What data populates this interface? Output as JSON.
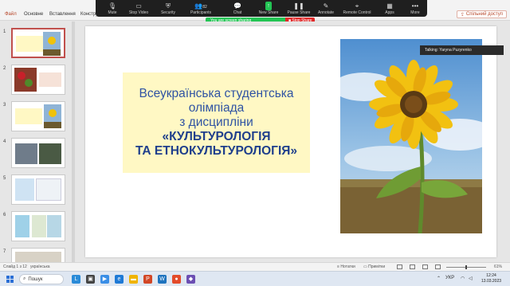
{
  "menu": {
    "file": "Файл",
    "home": "Основне",
    "insert": "Вставлення",
    "design": "Конструктор",
    "share": "Спільний доступ"
  },
  "zoom_toolbar": {
    "items": [
      {
        "label": "Mute",
        "icon": "mic-icon"
      },
      {
        "label": "Stop Video",
        "icon": "video-icon"
      },
      {
        "label": "Security",
        "icon": "shield-icon"
      },
      {
        "label": "Participants",
        "icon": "participants-icon",
        "count": "82"
      },
      {
        "label": "Chat",
        "icon": "chat-icon"
      },
      {
        "label": "New Share",
        "icon": "share-up-icon"
      },
      {
        "label": "Pause Share",
        "icon": "pause-icon"
      },
      {
        "label": "Annotate",
        "icon": "pen-icon"
      },
      {
        "label": "Remote Control",
        "icon": "remote-control-icon"
      },
      {
        "label": "Apps",
        "icon": "apps-icon"
      },
      {
        "label": "More",
        "icon": "more-icon"
      }
    ],
    "sharing_text": "You are screen sharing",
    "stop_share": "Stop Share",
    "accent": "#23c454",
    "stop_color": "#e02828"
  },
  "talking": "Talking: Yaryna Puzyrenko",
  "thumbnails": {
    "numbers": [
      "1",
      "2",
      "3",
      "4",
      "5",
      "6",
      "7"
    ]
  },
  "slide": {
    "title_lines": [
      "Всеукраїнська студентська",
      "олімпіада",
      "з дисципліни"
    ],
    "subject_lines": [
      "«КУЛЬТУРОЛОГІЯ",
      "ТА ЕТНОКУЛЬТУРОЛОГІЯ»"
    ],
    "title_bg": "#fff8c4",
    "text_color": "#2f53a3"
  },
  "status": {
    "slide_of": "Слайд 1 з 12",
    "language": "українська",
    "notes": "Нотатки",
    "comments": "Примітки",
    "zoom": "61%",
    "zoom_level": 0.61
  },
  "taskbar": {
    "search": "Пошук",
    "lang": "УКР",
    "time": "12:24",
    "date": "13.03.2023"
  }
}
